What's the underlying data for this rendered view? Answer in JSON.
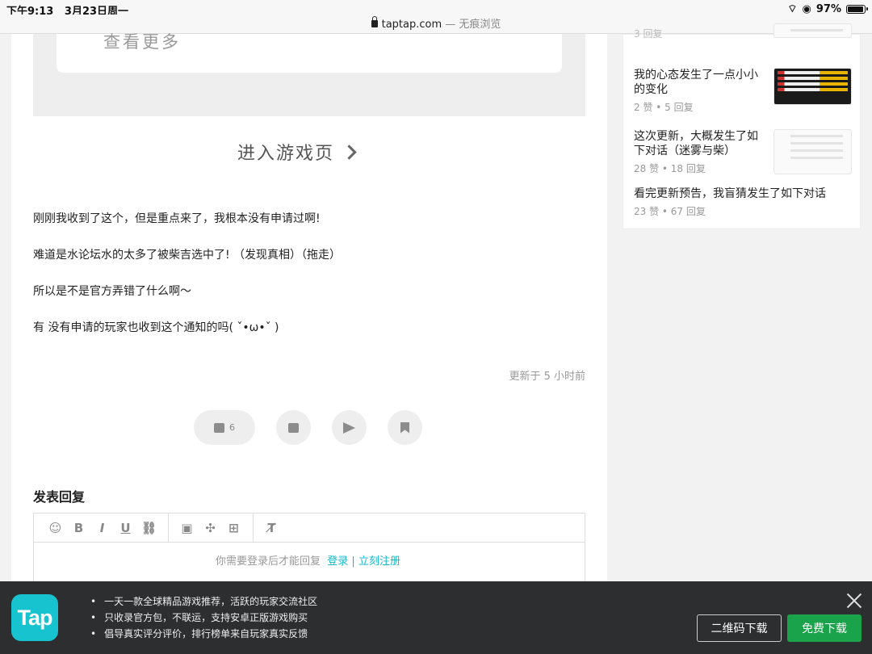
{
  "status": {
    "time": "下午9:13",
    "date": "3月23日周一",
    "battery": "97%",
    "battery_level": 0.97
  },
  "address": {
    "domain": "taptap.com",
    "mode": " — 无痕浏览"
  },
  "game_card": {
    "more": "查看更多",
    "enter_game": "进入游戏页"
  },
  "post": {
    "paragraphs": [
      "刚刚我收到了这个，但是重点来了，我根本没有申请过啊!",
      "难道是水论坛水的太多了被柴吉选中了! （发现真相）（拖走）",
      "所以是不是官方弄错了什么啊～",
      "有 没有申请的玩家也收到这个通知的吗( ˇ•ω•ˇ )"
    ],
    "updated": "更新于 5 小时前",
    "likes": "6"
  },
  "reply": {
    "title": "发表回复",
    "login_prefix": "你需要登录后才能回复",
    "login": "登录",
    "divider": " | ",
    "register": "立刻注册"
  },
  "sidebar": {
    "partial_meta": "3 回复",
    "items": [
      {
        "title": "我的心态发生了一点小小的变化",
        "meta": "2 赞 • 5 回复"
      },
      {
        "title": "这次更新，大概发生了如下对话（迷雾与柴）",
        "meta": "28 赞 • 18 回复"
      },
      {
        "title": "看完更新预告，我盲猜发生了如下对话",
        "meta": "23 赞 • 67 回复"
      }
    ]
  },
  "banner": {
    "logo": "Tap",
    "features": [
      "一天一款全球精品游戏推荐，活跃的玩家交流社区",
      "只收录官方包，不联运，支持安卓正版游戏购买",
      "倡导真实评分评价，排行榜单来自玩家真实反馈"
    ],
    "qr_button": "二维码下载",
    "download_button": "免费下载"
  }
}
